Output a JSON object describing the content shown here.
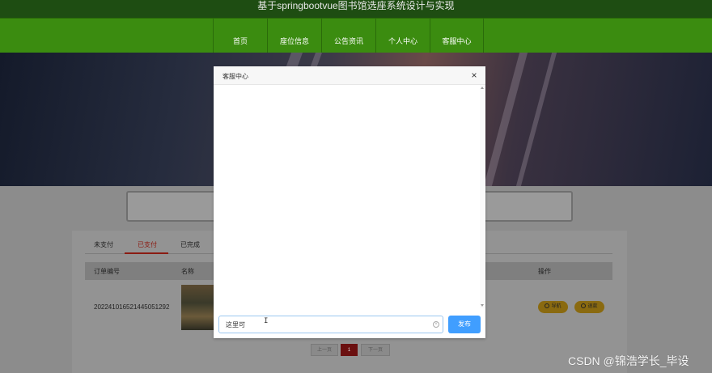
{
  "site": {
    "title": "基于springbootvue图书馆选座系统设计与实现"
  },
  "nav": {
    "items": [
      "首页",
      "座位信息",
      "公告资讯",
      "个人中心",
      "客服中心"
    ]
  },
  "order_tabs": {
    "items": [
      "未支付",
      "已支付",
      "已完成"
    ],
    "active": "已支付"
  },
  "table": {
    "columns": {
      "order_no": "订单编号",
      "name": "名称",
      "actions": "操作"
    },
    "rows": [
      {
        "order_no": "20224101652144505​1292"
      }
    ],
    "action_buttons": [
      "导航",
      "退款"
    ]
  },
  "pagination": {
    "prev_label": "上一页",
    "current_page": "1",
    "next_label": "下一页"
  },
  "dialog": {
    "title": "客服中心",
    "close_glyph": "×",
    "input_value": "这里可",
    "input_placeholder": "",
    "send_label": "发布"
  },
  "watermark": "CSDN @锦浩学长_毕设"
}
